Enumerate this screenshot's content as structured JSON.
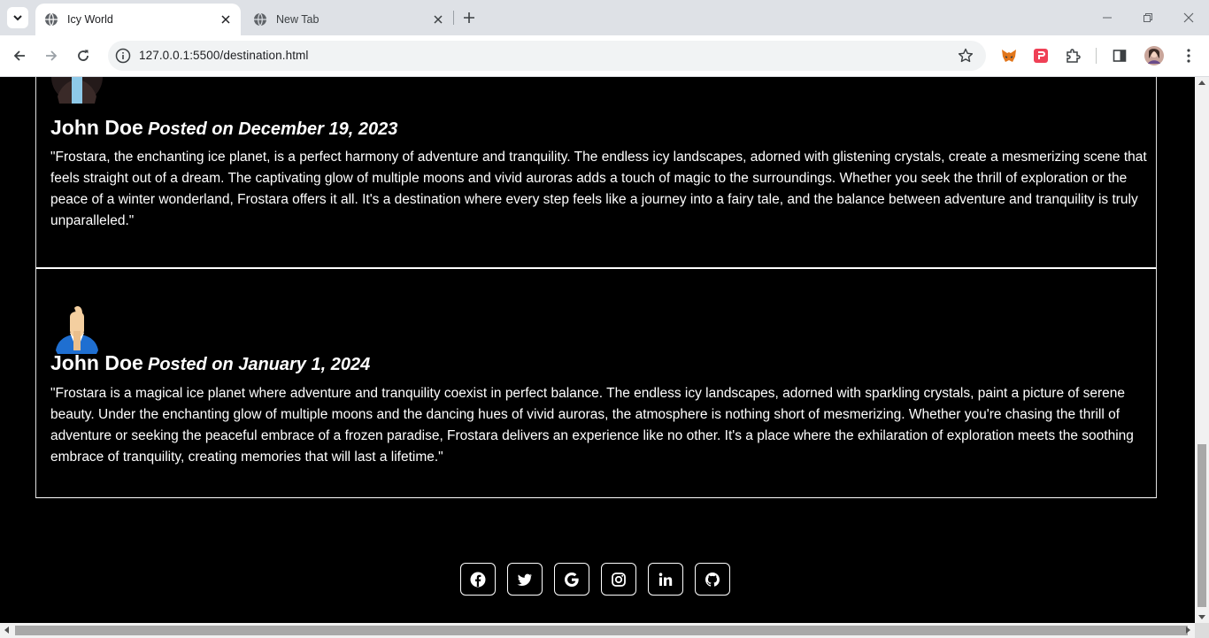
{
  "browser": {
    "tabs": [
      {
        "title": "Icy World",
        "active": true
      },
      {
        "title": "New Tab",
        "active": false
      }
    ],
    "url": "127.0.0.1:5500/destination.html"
  },
  "reviews": [
    {
      "name": "John Doe",
      "posted": "Posted on December 19, 2023",
      "text": "\"Frostara, the enchanting ice planet, is a perfect harmony of adventure and tranquility. The endless icy landscapes, adorned with glistening crystals, create a mesmerizing scene that feels straight out of a dream. The captivating glow of multiple moons and vivid auroras adds a touch of magic to the surroundings. Whether you seek the thrill of exploration or the peace of a winter wonderland, Frostara offers it all. It's a destination where every step feels like a journey into a fairy tale, and the balance between adventure and tranquility is truly unparalleled.\""
    },
    {
      "name": "John Doe",
      "posted": "Posted on January 1, 2024",
      "text": "\"Frostara is a magical ice planet where adventure and tranquility coexist in perfect balance. The endless icy landscapes, adorned with sparkling crystals, paint a picture of serene beauty. Under the enchanting glow of multiple moons and the dancing hues of vivid auroras, the atmosphere is nothing short of mesmerizing. Whether you're chasing the thrill of adventure or seeking the peaceful embrace of a frozen paradise, Frostara delivers an experience like no other. It's a place where the exhilaration of exploration meets the soothing embrace of tranquility, creating memories that will last a lifetime.\""
    }
  ],
  "footer": {
    "social_icons": [
      "facebook-icon",
      "twitter-icon",
      "google-icon",
      "instagram-icon",
      "linkedin-icon",
      "github-icon"
    ]
  }
}
